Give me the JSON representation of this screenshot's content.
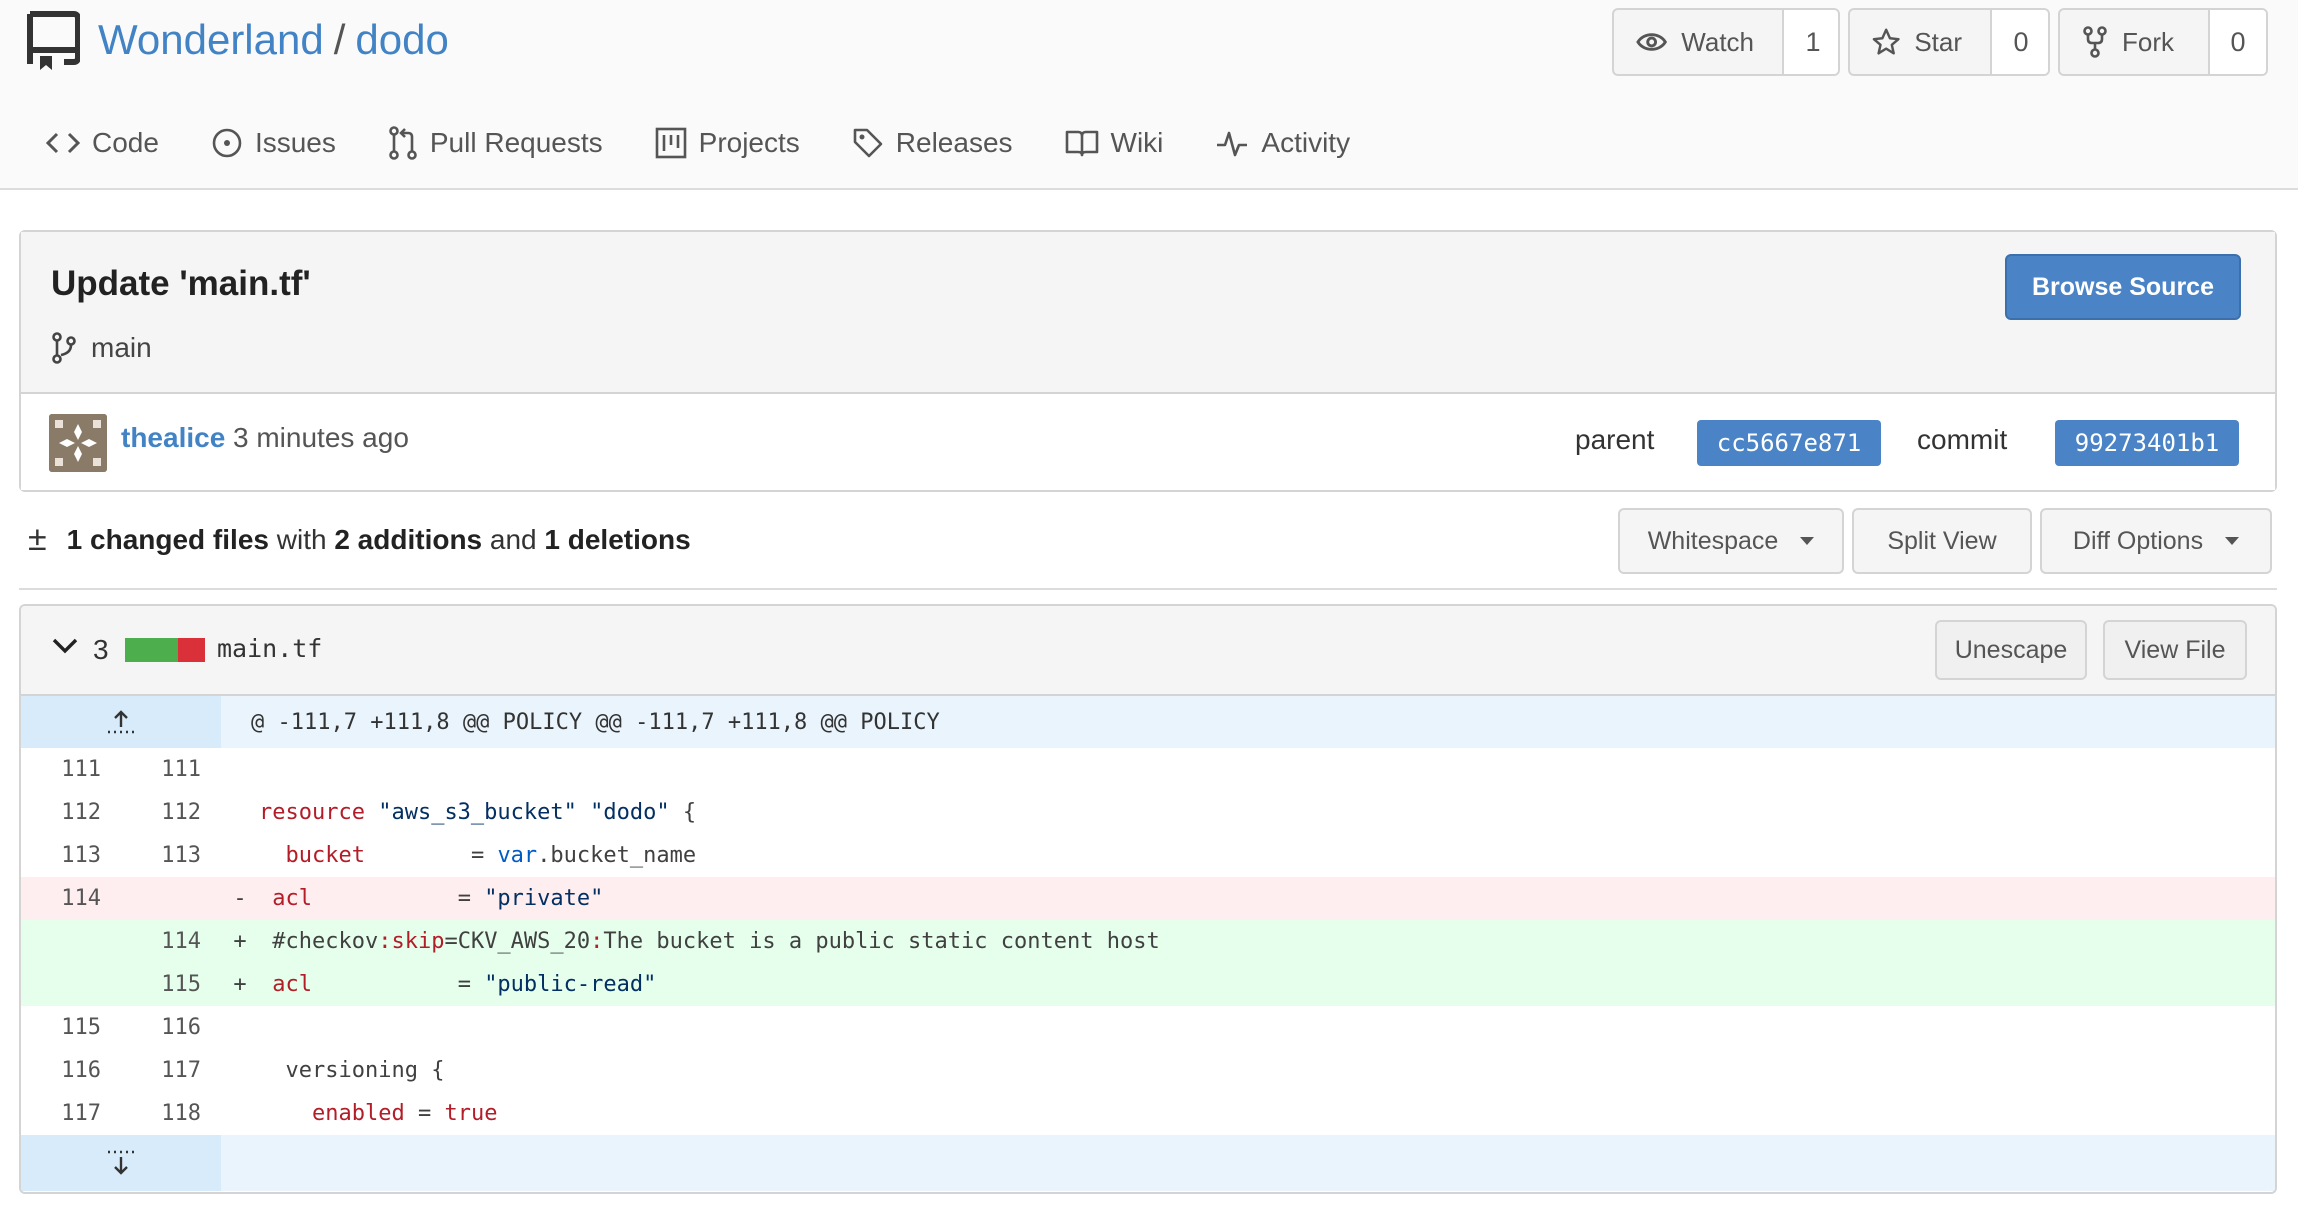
{
  "repo": {
    "owner": "Wonderland",
    "separator": "/",
    "name": "dodo"
  },
  "actions": {
    "watch": {
      "label": "Watch",
      "count": "1"
    },
    "star": {
      "label": "Star",
      "count": "0"
    },
    "fork": {
      "label": "Fork",
      "count": "0"
    }
  },
  "tabs": [
    {
      "label": "Code",
      "icon": "code-icon"
    },
    {
      "label": "Issues",
      "icon": "issue-icon"
    },
    {
      "label": "Pull Requests",
      "icon": "pull-request-icon"
    },
    {
      "label": "Projects",
      "icon": "project-icon"
    },
    {
      "label": "Releases",
      "icon": "tag-icon"
    },
    {
      "label": "Wiki",
      "icon": "book-icon"
    },
    {
      "label": "Activity",
      "icon": "pulse-icon"
    }
  ],
  "commit": {
    "title": "Update 'main.tf'",
    "branch": "main",
    "browse_label": "Browse Source",
    "author": "thealice",
    "time": "3 minutes ago",
    "parent_label": "parent",
    "parent_sha": "cc5667e871",
    "commit_label": "commit",
    "commit_sha": "99273401b1"
  },
  "stats": {
    "pm": "±",
    "files": "1 changed files",
    "with": "with",
    "additions": "2 additions",
    "and": "and",
    "deletions": "1 deletions"
  },
  "options": {
    "whitespace": "Whitespace",
    "split": "Split View",
    "diff": "Diff Options"
  },
  "file": {
    "changes": "3",
    "name": "main.tf",
    "unescape": "Unescape",
    "view": "View File",
    "hunk": "@ -111,7 +111,8 @@ POLICY @@ -111,7 +111,8 @@ POLICY",
    "lines": [
      {
        "old": "111",
        "new": "111",
        "sign": "",
        "type": "ctx"
      },
      {
        "old": "112",
        "new": "112",
        "sign": "",
        "type": "ctx"
      },
      {
        "old": "113",
        "new": "113",
        "sign": "",
        "type": "ctx"
      },
      {
        "old": "114",
        "new": "",
        "sign": "-",
        "type": "del"
      },
      {
        "old": "",
        "new": "114",
        "sign": "+",
        "type": "add"
      },
      {
        "old": "",
        "new": "115",
        "sign": "+",
        "type": "add"
      },
      {
        "old": "115",
        "new": "116",
        "sign": "",
        "type": "ctx"
      },
      {
        "old": "116",
        "new": "117",
        "sign": "",
        "type": "ctx"
      },
      {
        "old": "117",
        "new": "118",
        "sign": "",
        "type": "ctx"
      }
    ],
    "code": {
      "l2a": "resource",
      "l2b": " \"aws_s3_bucket\" \"dodo\"",
      "l2c": " {",
      "l3a": "bucket",
      "l3b": "        = ",
      "l3c": "var",
      "l3d": ".bucket_name",
      "l4a": "acl",
      "l4b": "           = ",
      "l4c": "\"private\"",
      "l5a": "#checkov",
      "l5b": ":skip",
      "l5c": "=CKV_AWS_20",
      "l5d": ":",
      "l5e": "The bucket is a public static content host",
      "l6a": "acl",
      "l6b": "           = ",
      "l6c": "\"public-read\"",
      "l8a": "versioning {",
      "l9a": "enabled",
      "l9b": " = ",
      "l9c": "true"
    }
  }
}
